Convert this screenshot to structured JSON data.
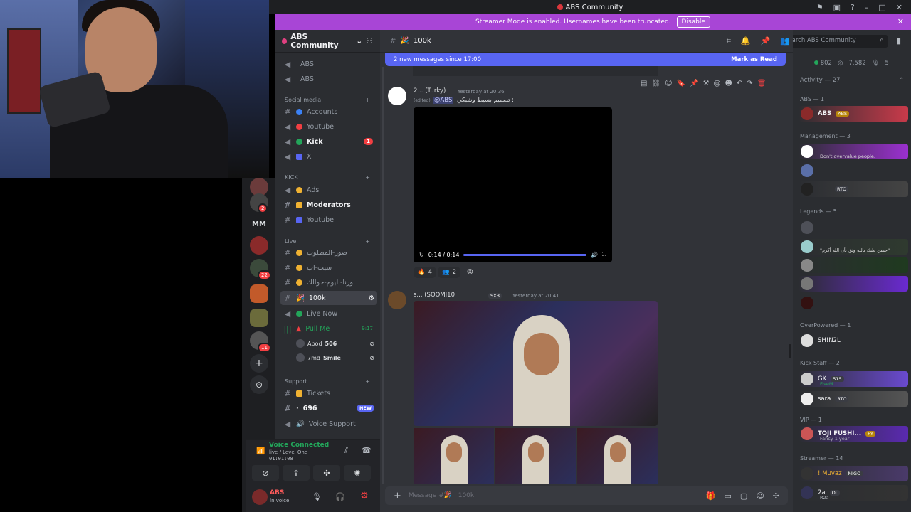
{
  "window": {
    "title": "ABS Community"
  },
  "streamer_bar": {
    "text": "Streamer Mode is enabled. Usernames have been truncated.",
    "disable_label": "Disable"
  },
  "server": {
    "name": "ABS Community"
  },
  "servers": {
    "label_mm": "MM",
    "badges": [
      "2",
      "22",
      "11"
    ]
  },
  "channels": {
    "top": [
      {
        "name": "· ABS"
      },
      {
        "name": "· ABS"
      }
    ],
    "cat_social": "Social media",
    "social": [
      {
        "name": "Accounts"
      },
      {
        "name": "Youtube"
      },
      {
        "name": "Kick",
        "badge": "1"
      },
      {
        "name": "X"
      }
    ],
    "cat_kick": "KICK",
    "kick": [
      {
        "name": "Ads"
      },
      {
        "name": "Moderators"
      },
      {
        "name": "Youtube"
      }
    ],
    "cat_live": "Live",
    "live": [
      {
        "name": "صور-المطلوب"
      },
      {
        "name": "سيت-اب"
      },
      {
        "name": "ورنا-اليوم-جوالك"
      },
      {
        "name": "100k"
      },
      {
        "name": "Live Now"
      },
      {
        "name": "Pull Me",
        "time": "9:17"
      }
    ],
    "voice_users": [
      {
        "name": "Abod",
        "tag": "506"
      },
      {
        "name": "7md",
        "tag": "Smile"
      }
    ],
    "cat_support": "Support",
    "support": [
      {
        "name": "Tickets"
      },
      {
        "name": "696",
        "badge": "NEW"
      },
      {
        "name": "Voice Support"
      }
    ]
  },
  "voice_panel": {
    "status": "Voice Connected",
    "channel": "live / Level One",
    "timer": "01:01:08"
  },
  "user_panel": {
    "name": "ABS",
    "status": "In voice"
  },
  "chat": {
    "channel": "100k",
    "new_messages": "2 new messages since 17:00",
    "mark_read": "Mark as Read",
    "msg1": {
      "user": "2... (Turky)",
      "time": "Yesterday at 20:36",
      "edited": "(edited)",
      "mention": "@ABS",
      "text": "تصميم بسيط وشبكي :",
      "video_time": "0:14 / 0:14",
      "reactions": [
        "4",
        "2"
      ]
    },
    "msg2": {
      "user": "s... (SOOMI10",
      "tag": "SXB",
      "time": "Yesterday at 20:41"
    },
    "compose_placeholder": "Message #🎉 | 100k"
  },
  "members": {
    "search_placeholder": "Search ABS Community",
    "counts": {
      "online": "802",
      "total": "7,582",
      "voice": "5"
    },
    "activity": "Activity — 27",
    "sections": [
      {
        "title": "ABS — 1"
      },
      {
        "title": "Management — 3"
      },
      {
        "title": "Legends — 5"
      },
      {
        "title": "OverPowered — 1"
      },
      {
        "title": "Kick Staff — 2"
      },
      {
        "title": "VIP — 1"
      },
      {
        "title": "Streamer — 14"
      }
    ],
    "abs_member": {
      "name": "ABS",
      "tag": "ABS"
    },
    "management_sub": "Don't overvalue people.",
    "rto": "RTO",
    "legend_text": "\"حسن ظنك بالله وثق بأن الله أكرم\"",
    "overpowered": "SH!N2L",
    "kick_staff": [
      {
        "name": "GK",
        "tag": "515",
        "sub": "FiveM"
      },
      {
        "name": "sara",
        "tag": "RTO"
      }
    ],
    "vip": {
      "name": "TOJI FUSHI...",
      "tag": "FY",
      "sub": "Fancy 1 year"
    },
    "streamers": [
      {
        "name": "! Muvaz",
        "tag": "MIGO"
      },
      {
        "name": "2a",
        "tag": "OL",
        "sub": "R2a"
      }
    ]
  },
  "colors": {
    "accent": "#5865f2",
    "streamer": "#a845d6",
    "danger": "#f23f42",
    "online": "#23a55a"
  }
}
